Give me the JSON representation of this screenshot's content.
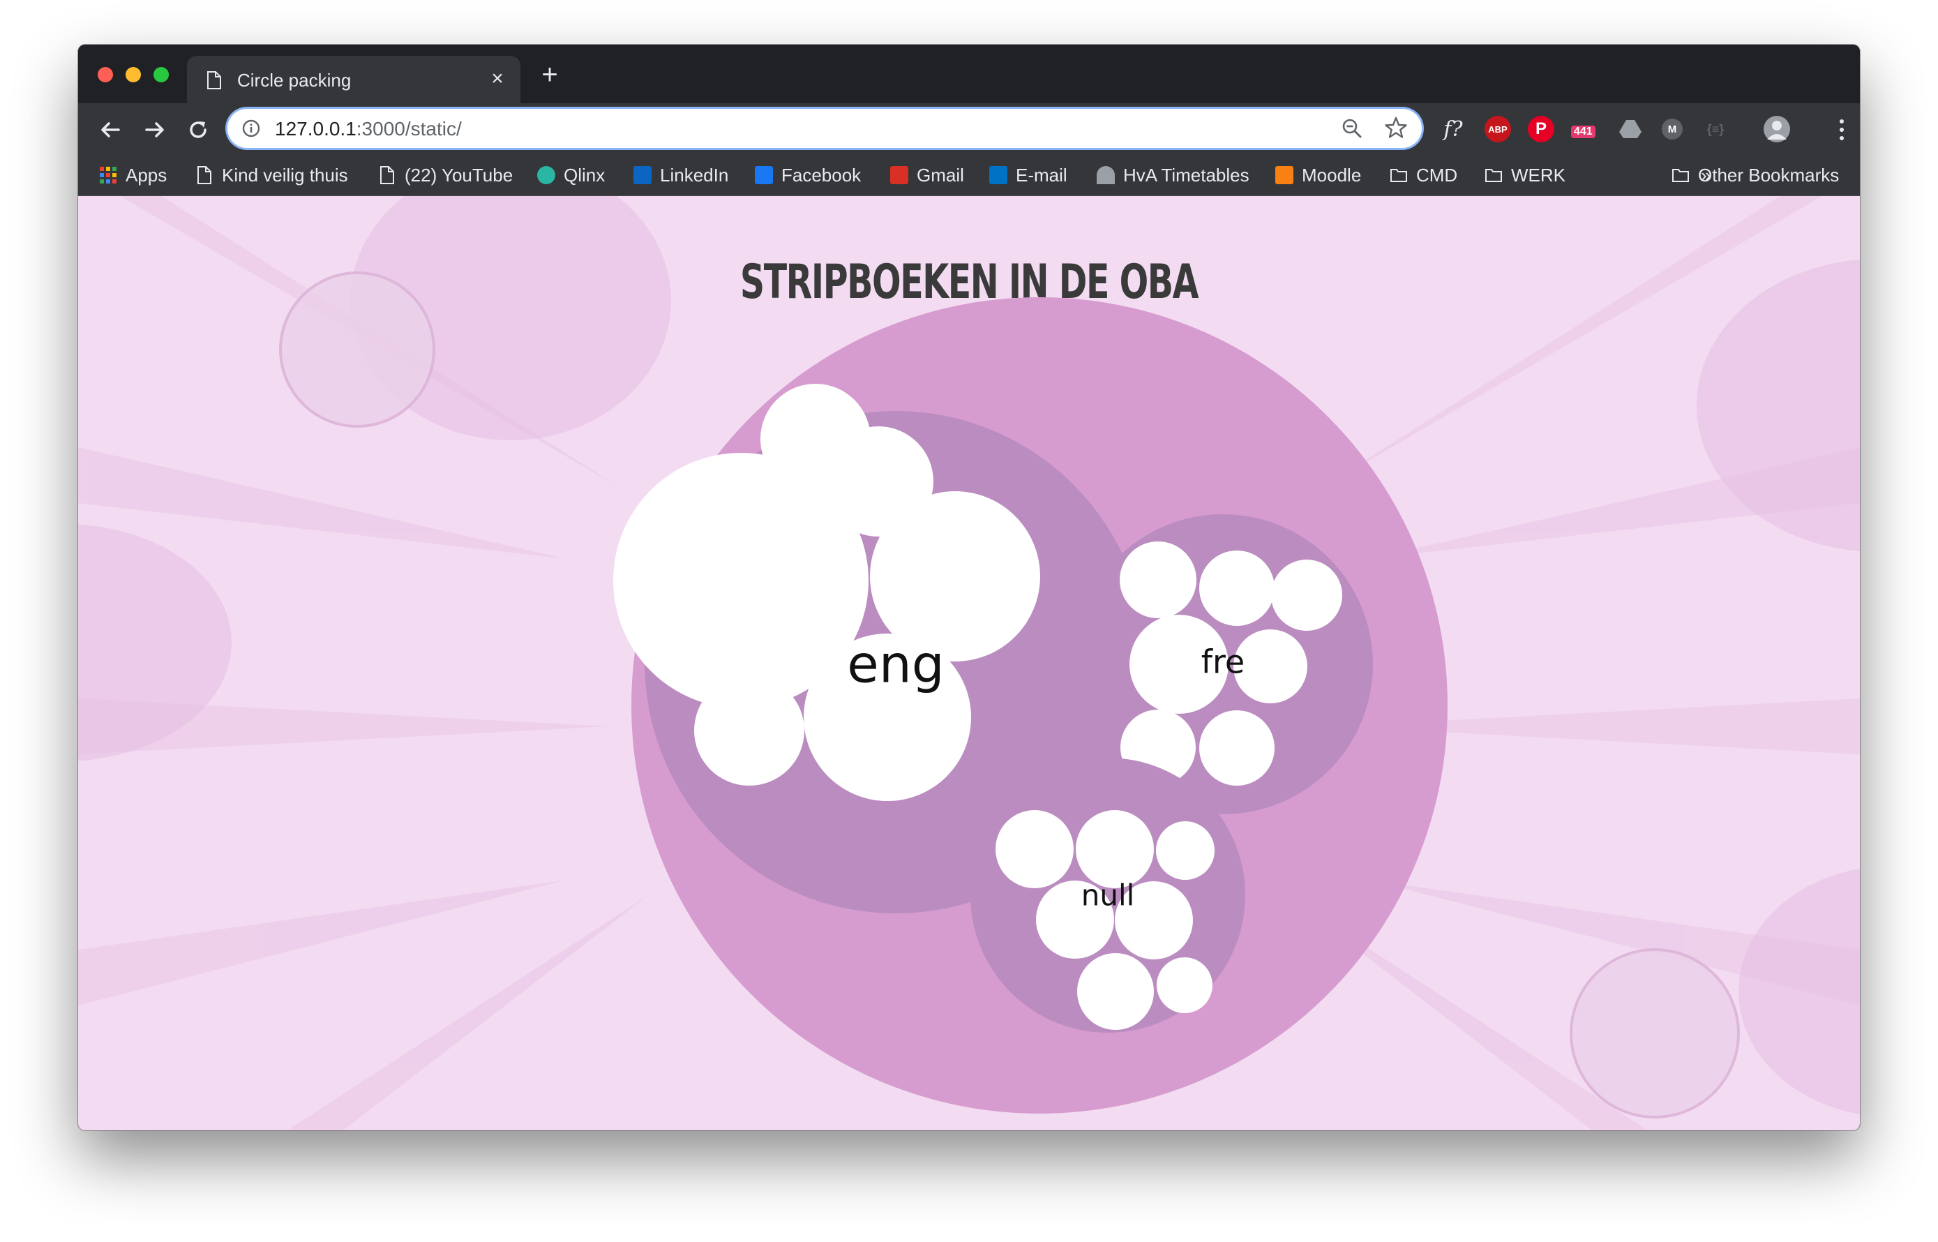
{
  "browser": {
    "tab": {
      "title": "Circle packing",
      "close": "×"
    },
    "new_tab": "+",
    "url": {
      "host": "127.0.0.1",
      "path": ":3000/static/"
    },
    "ext_abp": "ABP",
    "ext_badge": "441",
    "ext_fx": "f?",
    "ext_m": "M",
    "ext_s": "{≡}",
    "bookmarks": [
      {
        "label": "Apps",
        "icon": "apps-grid-icon"
      },
      {
        "label": "Kind veilig thuis",
        "icon": "page-icon"
      },
      {
        "label": "(22) YouTube",
        "icon": "page-icon"
      },
      {
        "label": "Qlinx",
        "icon": "qlinx-icon"
      },
      {
        "label": "LinkedIn",
        "icon": "linkedin-icon"
      },
      {
        "label": "Facebook",
        "icon": "facebook-icon"
      },
      {
        "label": "Gmail",
        "icon": "gmail-icon"
      },
      {
        "label": "E-mail",
        "icon": "outlook-icon"
      },
      {
        "label": "HvA Timetables",
        "icon": "hva-icon"
      },
      {
        "label": "Moodle",
        "icon": "moodle-icon"
      },
      {
        "label": "CMD",
        "icon": "folder-icon"
      },
      {
        "label": "WERK",
        "icon": "folder-icon"
      }
    ],
    "bookmarks_overflow": "»",
    "other_bookmarks": "Other Bookmarks"
  },
  "page": {
    "title": "STRIPBOEKEN IN DE OBA",
    "colors": {
      "background": "#f3dcf2",
      "root": "#d79ccf",
      "group": "#bb8cc0",
      "leaf": "#ffffff"
    },
    "groups": [
      {
        "label": "eng",
        "leaves": 7
      },
      {
        "label": "fre",
        "leaves": 7
      },
      {
        "label": "null",
        "leaves": 7
      }
    ]
  }
}
